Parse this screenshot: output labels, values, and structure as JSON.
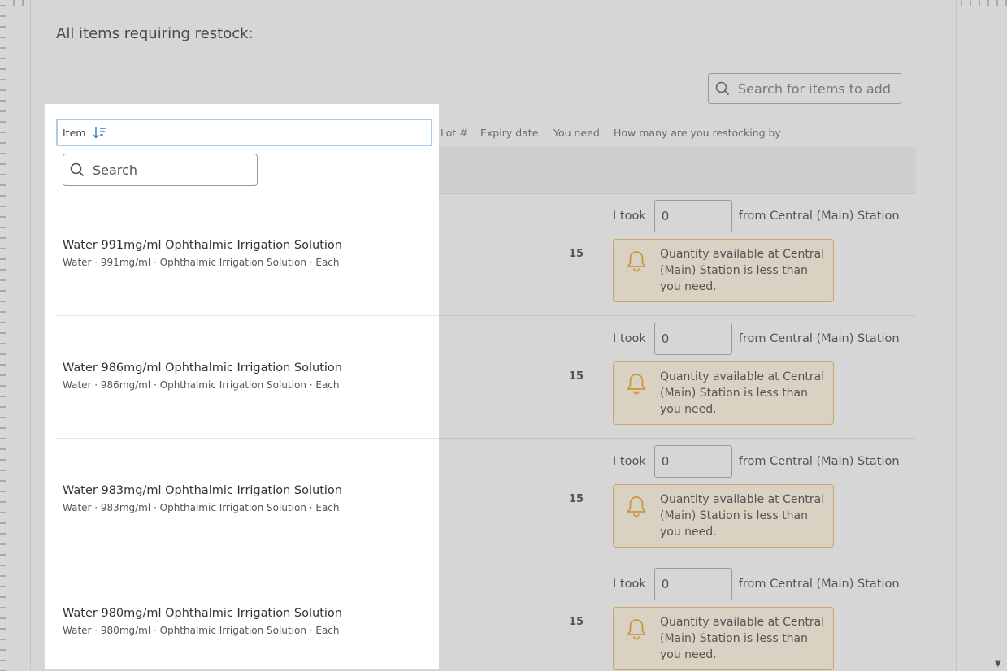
{
  "heading": "All items requiring restock:",
  "search": {
    "placeholder": "Search for items to add"
  },
  "columns": {
    "item": "Item",
    "lot": "Lot #",
    "expiry": "Expiry date",
    "need": "You need",
    "restock": "How many are you restocking by"
  },
  "filter": {
    "placeholder": "Search"
  },
  "icons": {
    "sort": "sort-descending-icon",
    "search": "search-icon",
    "alert": "bell-icon"
  },
  "colors": {
    "focus_border": "#a9cdea",
    "sort_icon": "#3b82c4",
    "alert_border": "#c9a668",
    "alert_bell": "#c9963c"
  },
  "rows": [
    {
      "name": "Water 991mg/ml Ophthalmic Irrigation Solution",
      "detail": "Water · 991mg/ml · Ophthalmic Irrigation Solution · Each",
      "need": "15",
      "took_prefix": "I took",
      "took_value": "0",
      "took_suffix": "from Central (Main) Station",
      "alert": "Quantity available at Central (Main) Station is less than you need."
    },
    {
      "name": "Water 986mg/ml Ophthalmic Irrigation Solution",
      "detail": "Water · 986mg/ml · Ophthalmic Irrigation Solution · Each",
      "need": "15",
      "took_prefix": "I took",
      "took_value": "0",
      "took_suffix": "from Central (Main) Station",
      "alert": "Quantity available at Central (Main) Station is less than you need."
    },
    {
      "name": "Water 983mg/ml Ophthalmic Irrigation Solution",
      "detail": "Water · 983mg/ml · Ophthalmic Irrigation Solution · Each",
      "need": "15",
      "took_prefix": "I took",
      "took_value": "0",
      "took_suffix": "from Central (Main) Station",
      "alert": "Quantity available at Central (Main) Station is less than you need."
    },
    {
      "name": "Water 980mg/ml Ophthalmic Irrigation Solution",
      "detail": "Water · 980mg/ml · Ophthalmic Irrigation Solution · Each",
      "need": "15",
      "took_prefix": "I took",
      "took_value": "0",
      "took_suffix": "from Central (Main) Station",
      "alert": "Quantity available at Central (Main) Station is less than you need."
    }
  ]
}
